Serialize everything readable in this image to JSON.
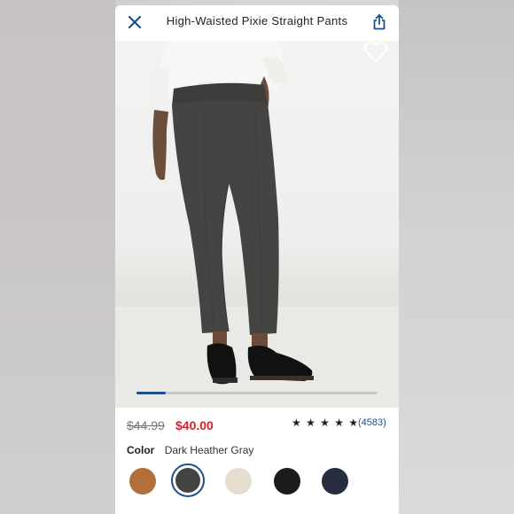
{
  "header": {
    "title": "High-Waisted Pixie Straight Pants"
  },
  "gallery": {
    "progress": 0.12
  },
  "pricing": {
    "original_price": "$44.99",
    "sale_price": "$40.00",
    "rating_stars": "★ ★ ★ ★ ★",
    "rating_value": 4.5,
    "review_count": "(4583)"
  },
  "color": {
    "label": "Color",
    "selected_name": "Dark Heather Gray",
    "swatches": [
      {
        "name": "Caramel",
        "color": "#b36e3a"
      },
      {
        "name": "Dark Heather Gray",
        "color": "#444444",
        "selected": true
      },
      {
        "name": "Cream",
        "color": "#e5ddd0"
      },
      {
        "name": "Black",
        "color": "#1b1b1b"
      },
      {
        "name": "Navy",
        "color": "#272d3f"
      }
    ]
  },
  "colors": {
    "accent": "#1a4f8b",
    "sale": "#d2232a"
  }
}
